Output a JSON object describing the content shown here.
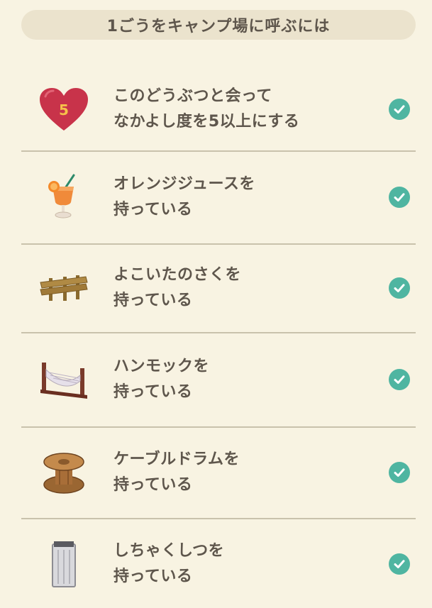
{
  "header": {
    "title": "1ごうをキャンプ場に呼ぶには"
  },
  "colors": {
    "background": "#f8f3e2",
    "header_bg": "#ebe3cd",
    "check": "#4fb5a1",
    "heart": "#c8334a",
    "heart_number": "#f6c24a"
  },
  "conditions": [
    {
      "icon": "heart-icon",
      "icon_text": "5",
      "line1": "このどうぶつと会って",
      "line2": "なかよし度を5以上にする",
      "completed": true
    },
    {
      "icon": "orange-juice-icon",
      "line1": "オレンジジュースを",
      "line2": "持っている",
      "completed": true
    },
    {
      "icon": "side-fence-icon",
      "line1": "よこいたのさくを",
      "line2": "持っている",
      "completed": true
    },
    {
      "icon": "hammock-icon",
      "line1": "ハンモックを",
      "line2": "持っている",
      "completed": true
    },
    {
      "icon": "cable-drum-icon",
      "line1": "ケーブルドラムを",
      "line2": "持っている",
      "completed": true
    },
    {
      "icon": "trash-can-icon",
      "line1": "しちゃくしつを",
      "line2": "持っている",
      "completed": true
    }
  ]
}
